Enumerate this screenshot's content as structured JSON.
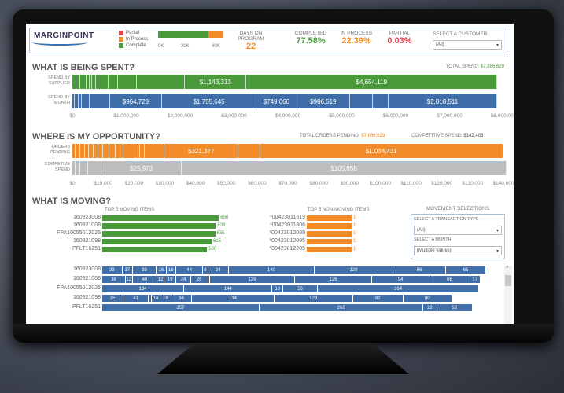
{
  "colors": {
    "green": "#4a9a3c",
    "orange": "#f28c28",
    "blue": "#3f6ea8",
    "gray": "#bdbdbd",
    "red": "#e0444c"
  },
  "header": {
    "logo": "MARGINPOINT",
    "legend": [
      {
        "label": "Partial",
        "color": "#e0444c"
      },
      {
        "label": "In Process",
        "color": "#f28c28"
      },
      {
        "label": "Complete",
        "color": "#4a9a3c"
      }
    ],
    "progress": {
      "complete_pct": 77.58,
      "in_process_pct": 22.39,
      "ticks": [
        "0K",
        "20K",
        "40K"
      ]
    },
    "kpis": [
      {
        "label": "DAYS ON PROGRAM",
        "value": "22",
        "color": "#f28c28"
      },
      {
        "label": "COMPLETED",
        "value": "77.58%",
        "color": "#4a9a3c"
      },
      {
        "label": "IN PROCESS",
        "value": "22.39%",
        "color": "#f28c28"
      },
      {
        "label": "PARTIAL",
        "value": "0.03%",
        "color": "#e0444c"
      }
    ],
    "customer": {
      "label": "SELECT A CUSTOMER",
      "value": "(All)"
    }
  },
  "spent": {
    "title": "WHAT IS BEING SPENT?",
    "total_label": "TOTAL SPEND:",
    "total_value": "$7,886,629",
    "max": 8000000,
    "rows": [
      {
        "label": "SPEND BY SUPPLIER",
        "color": "#4a9a3c",
        "segments": [
          [
            80000,
            ""
          ],
          [
            70000,
            ""
          ],
          [
            60000,
            ""
          ],
          [
            55000,
            ""
          ],
          [
            50000,
            ""
          ],
          [
            45000,
            ""
          ],
          [
            45000,
            ""
          ],
          [
            40000,
            ""
          ],
          [
            40000,
            ""
          ],
          [
            180000,
            ""
          ],
          [
            180000,
            ""
          ],
          [
            350000,
            ""
          ],
          [
            894197,
            ""
          ],
          [
            1143313,
            "$1,143,313"
          ],
          [
            4654119,
            "$4,654,119"
          ]
        ]
      },
      {
        "label": "SPEND BY MONTH",
        "color": "#3f6ea8",
        "segments": [
          [
            40000,
            ""
          ],
          [
            40000,
            ""
          ],
          [
            40000,
            ""
          ],
          [
            50000,
            ""
          ],
          [
            150000,
            ""
          ],
          [
            380000,
            ""
          ],
          [
            964729,
            "$964,729"
          ],
          [
            1755645,
            "$1,755,645"
          ],
          [
            749066,
            "$749,066"
          ],
          [
            986519,
            "$986,519"
          ],
          [
            420000,
            ""
          ],
          [
            292159,
            ""
          ],
          [
            2018511,
            "$2,018,511"
          ]
        ]
      }
    ],
    "ticks": [
      "$0",
      "$1,000,000",
      "$2,000,000",
      "$3,000,000",
      "$4,000,000",
      "$5,000,000",
      "$6,000,000",
      "$7,000,000",
      "$8,000,000"
    ]
  },
  "opportunity": {
    "title": "WHERE IS MY OPPORTUNITY?",
    "pending_label": "TOTAL ORDERS PENDING:",
    "pending_value": "$7,886,629",
    "comp_label": "COMPETITIVE SPEND:",
    "comp_value": "$142,403",
    "max": 140000,
    "rows": [
      {
        "label": "ORDERS PENDING",
        "color": "#f28c28",
        "segments": [
          [
            1000,
            ""
          ],
          [
            1500,
            ""
          ],
          [
            1500,
            ""
          ],
          [
            1500,
            ""
          ],
          [
            1500,
            ""
          ],
          [
            1500,
            ""
          ],
          [
            1500,
            ""
          ],
          [
            2000,
            ""
          ],
          [
            2000,
            ""
          ],
          [
            2500,
            ""
          ],
          [
            4000,
            ""
          ],
          [
            1500,
            ""
          ],
          [
            1500,
            ""
          ],
          [
            6500,
            ""
          ],
          [
            24000,
            "$321,377"
          ],
          [
            7000,
            ""
          ],
          [
            79000,
            "$1,034,431"
          ]
        ]
      },
      {
        "label": "COMPETIVE SPEND",
        "color": "#bdbdbd",
        "segments": [
          [
            1000,
            ""
          ],
          [
            1500,
            ""
          ],
          [
            2500,
            ""
          ],
          [
            4500,
            ""
          ],
          [
            25973,
            "$25,973"
          ],
          [
            105658,
            "$105,658"
          ]
        ]
      }
    ],
    "ticks": [
      "$0",
      "$10,000",
      "$20,000",
      "$30,000",
      "$40,000",
      "$50,000",
      "$60,000",
      "$70,000",
      "$80,000",
      "$90,000",
      "$100,000",
      "$110,000",
      "$120,000",
      "$130,000",
      "$140,000"
    ]
  },
  "moving": {
    "title": "WHAT IS MOVING?",
    "top_title": "TOP 5 MOVING ITEMS",
    "top": [
      {
        "item": "160923008",
        "value": 656
      },
      {
        "item": "160921008",
        "value": 639
      },
      {
        "item": "FPA10055012025",
        "value": 635
      },
      {
        "item": "160921098",
        "value": 615
      },
      {
        "item": "PFLT16251",
        "value": 590
      }
    ],
    "non_title": "TOP 5 NON-MOVING ITEMS",
    "non": [
      {
        "item": "*00423011619",
        "value": 1
      },
      {
        "item": "*00423011806",
        "value": 1
      },
      {
        "item": "*00423012089",
        "value": 1
      },
      {
        "item": "*00423012095",
        "value": 1
      },
      {
        "item": "*00423012205",
        "value": 1
      }
    ],
    "selections": {
      "title": "MOVEMENT SELECTIONS",
      "type_label": "SELECT A TRANSACTION TYPE",
      "type_value": "(All)",
      "month_label": "SELECT A MONTH",
      "month_value": "(Multiple values)"
    },
    "stacked": [
      {
        "item": "160923008",
        "segments": [
          33,
          17,
          39,
          16,
          16,
          44,
          8,
          34,
          140,
          129,
          86,
          65
        ]
      },
      {
        "item": "160921008",
        "segments": [
          38,
          12,
          40,
          12,
          19,
          24,
          28,
          3,
          139,
          126,
          94,
          66,
          17
        ]
      },
      {
        "item": "FPA10055012025",
        "segments": [
          134,
          144,
          18,
          56,
          264
        ]
      },
      {
        "item": "160921098",
        "segments": [
          35,
          41,
          5,
          14,
          18,
          34,
          134,
          129,
          82,
          80
        ]
      },
      {
        "item": "PFLT16251",
        "segments": [
          257,
          268,
          22,
          58
        ]
      }
    ]
  }
}
